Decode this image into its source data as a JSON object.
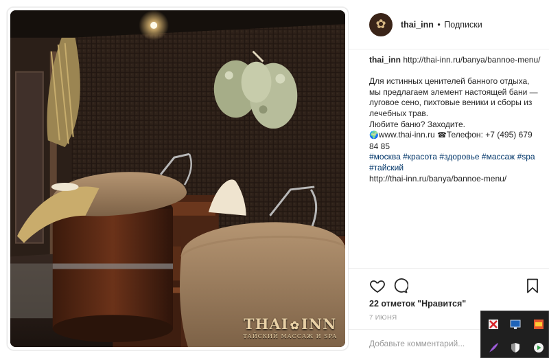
{
  "post": {
    "username": "thai_inn",
    "separator": "•",
    "follow_label": "Подписки",
    "watermark": {
      "main_left": "THAI",
      "main_right": "INN",
      "sub": "ТАЙСКИЙ МАССАЖ И SPA"
    },
    "caption": {
      "username": "thai_inn",
      "link_line": "http://thai-inn.ru/banya/bannoe-menu/",
      "paragraph": "Для истинных ценителей банного отдыха, мы предлагаем элемент настоящей бани — луговое сено, пихтовые веники и сборы из лечебных трав.",
      "question": "Любите баню? Заходите.",
      "site_emoji": "🌍",
      "site": "www.thai-inn.ru",
      "phone_emoji": "☎",
      "phone": "Телефон: +7 (495) 679 84 85",
      "hashtags": [
        "#москва",
        "#красота",
        "#здоровье",
        "#массаж",
        "#spa",
        "#тайский"
      ],
      "final_link": "http://thai-inn.ru/banya/bannoe-menu/"
    },
    "likes": "22 отметок \"Нравится\"",
    "date": "7 июня",
    "comment_placeholder": "Добавьте комментарий...",
    "icons": {
      "like": "heart-outline-icon",
      "comment": "speech-bubble-icon",
      "save": "bookmark-icon",
      "avatar": "lotus-flower-icon"
    }
  },
  "tray": {
    "icons": [
      "red-app-icon",
      "blue-monitor-icon",
      "red-orange-app-icon",
      "purple-feather-icon",
      "shield-icon",
      "green-play-icon"
    ]
  },
  "colors": {
    "hashtag": "#003569",
    "avatar_bg": "#3a2418",
    "watermark": "#e9d1a6"
  }
}
